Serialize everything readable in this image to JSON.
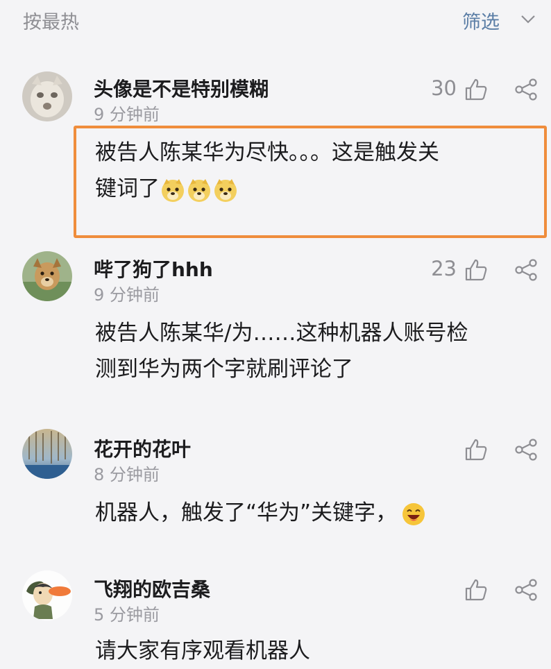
{
  "topbar": {
    "sort_label": "按最热",
    "filter_label": "筛选",
    "filter_icon": "chevron-down-icon"
  },
  "comments": [
    {
      "username": "头像是不是特别模糊",
      "time": "9 分钟前",
      "likes": "30",
      "text_line1": "被告人陈某华为尽快。。。这是触发关",
      "text_line2": "键词了",
      "emojis": [
        "doge-emoji",
        "doge-emoji",
        "doge-emoji"
      ]
    },
    {
      "username": "哔了狗了hhh",
      "time": "9 分钟前",
      "likes": "23",
      "text_line1": "被告人陈某华/为……这种机器人账号检",
      "text_line2": "测到华为两个字就刷评论了"
    },
    {
      "username": "花开的花叶",
      "time": "8 分钟前",
      "likes": "",
      "text_line1": "机器人，触发了“华为”关键字，",
      "emojis": [
        "laughing-emoji"
      ]
    },
    {
      "username": "飞翔的欧吉桑",
      "time": "5 分钟前",
      "likes": "",
      "text_line1": "请大家有序观看机器人"
    }
  ],
  "icons": {
    "like": "thumbs-up-icon",
    "share": "share-icon"
  },
  "colors": {
    "highlight_border": "#ef8d3c",
    "filter_accent": "#5b7ea6",
    "background": "#f4f4f6"
  }
}
